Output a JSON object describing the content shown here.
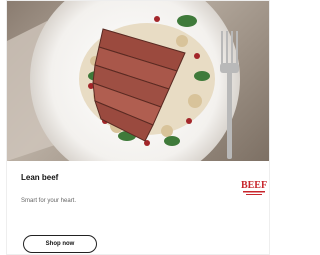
{
  "card": {
    "title": "Lean beef",
    "subtitle": "Smart for your heart.",
    "button_label": "Shop now",
    "logo_text": "BEEF"
  },
  "colors": {
    "background": "#ffffff",
    "button_border": "#222222",
    "logo_red": "#c8262c",
    "title_text": "#111111",
    "subtitle_text": "#666666"
  },
  "icons": [
    "steak-salad-photo",
    "beef-logo"
  ]
}
